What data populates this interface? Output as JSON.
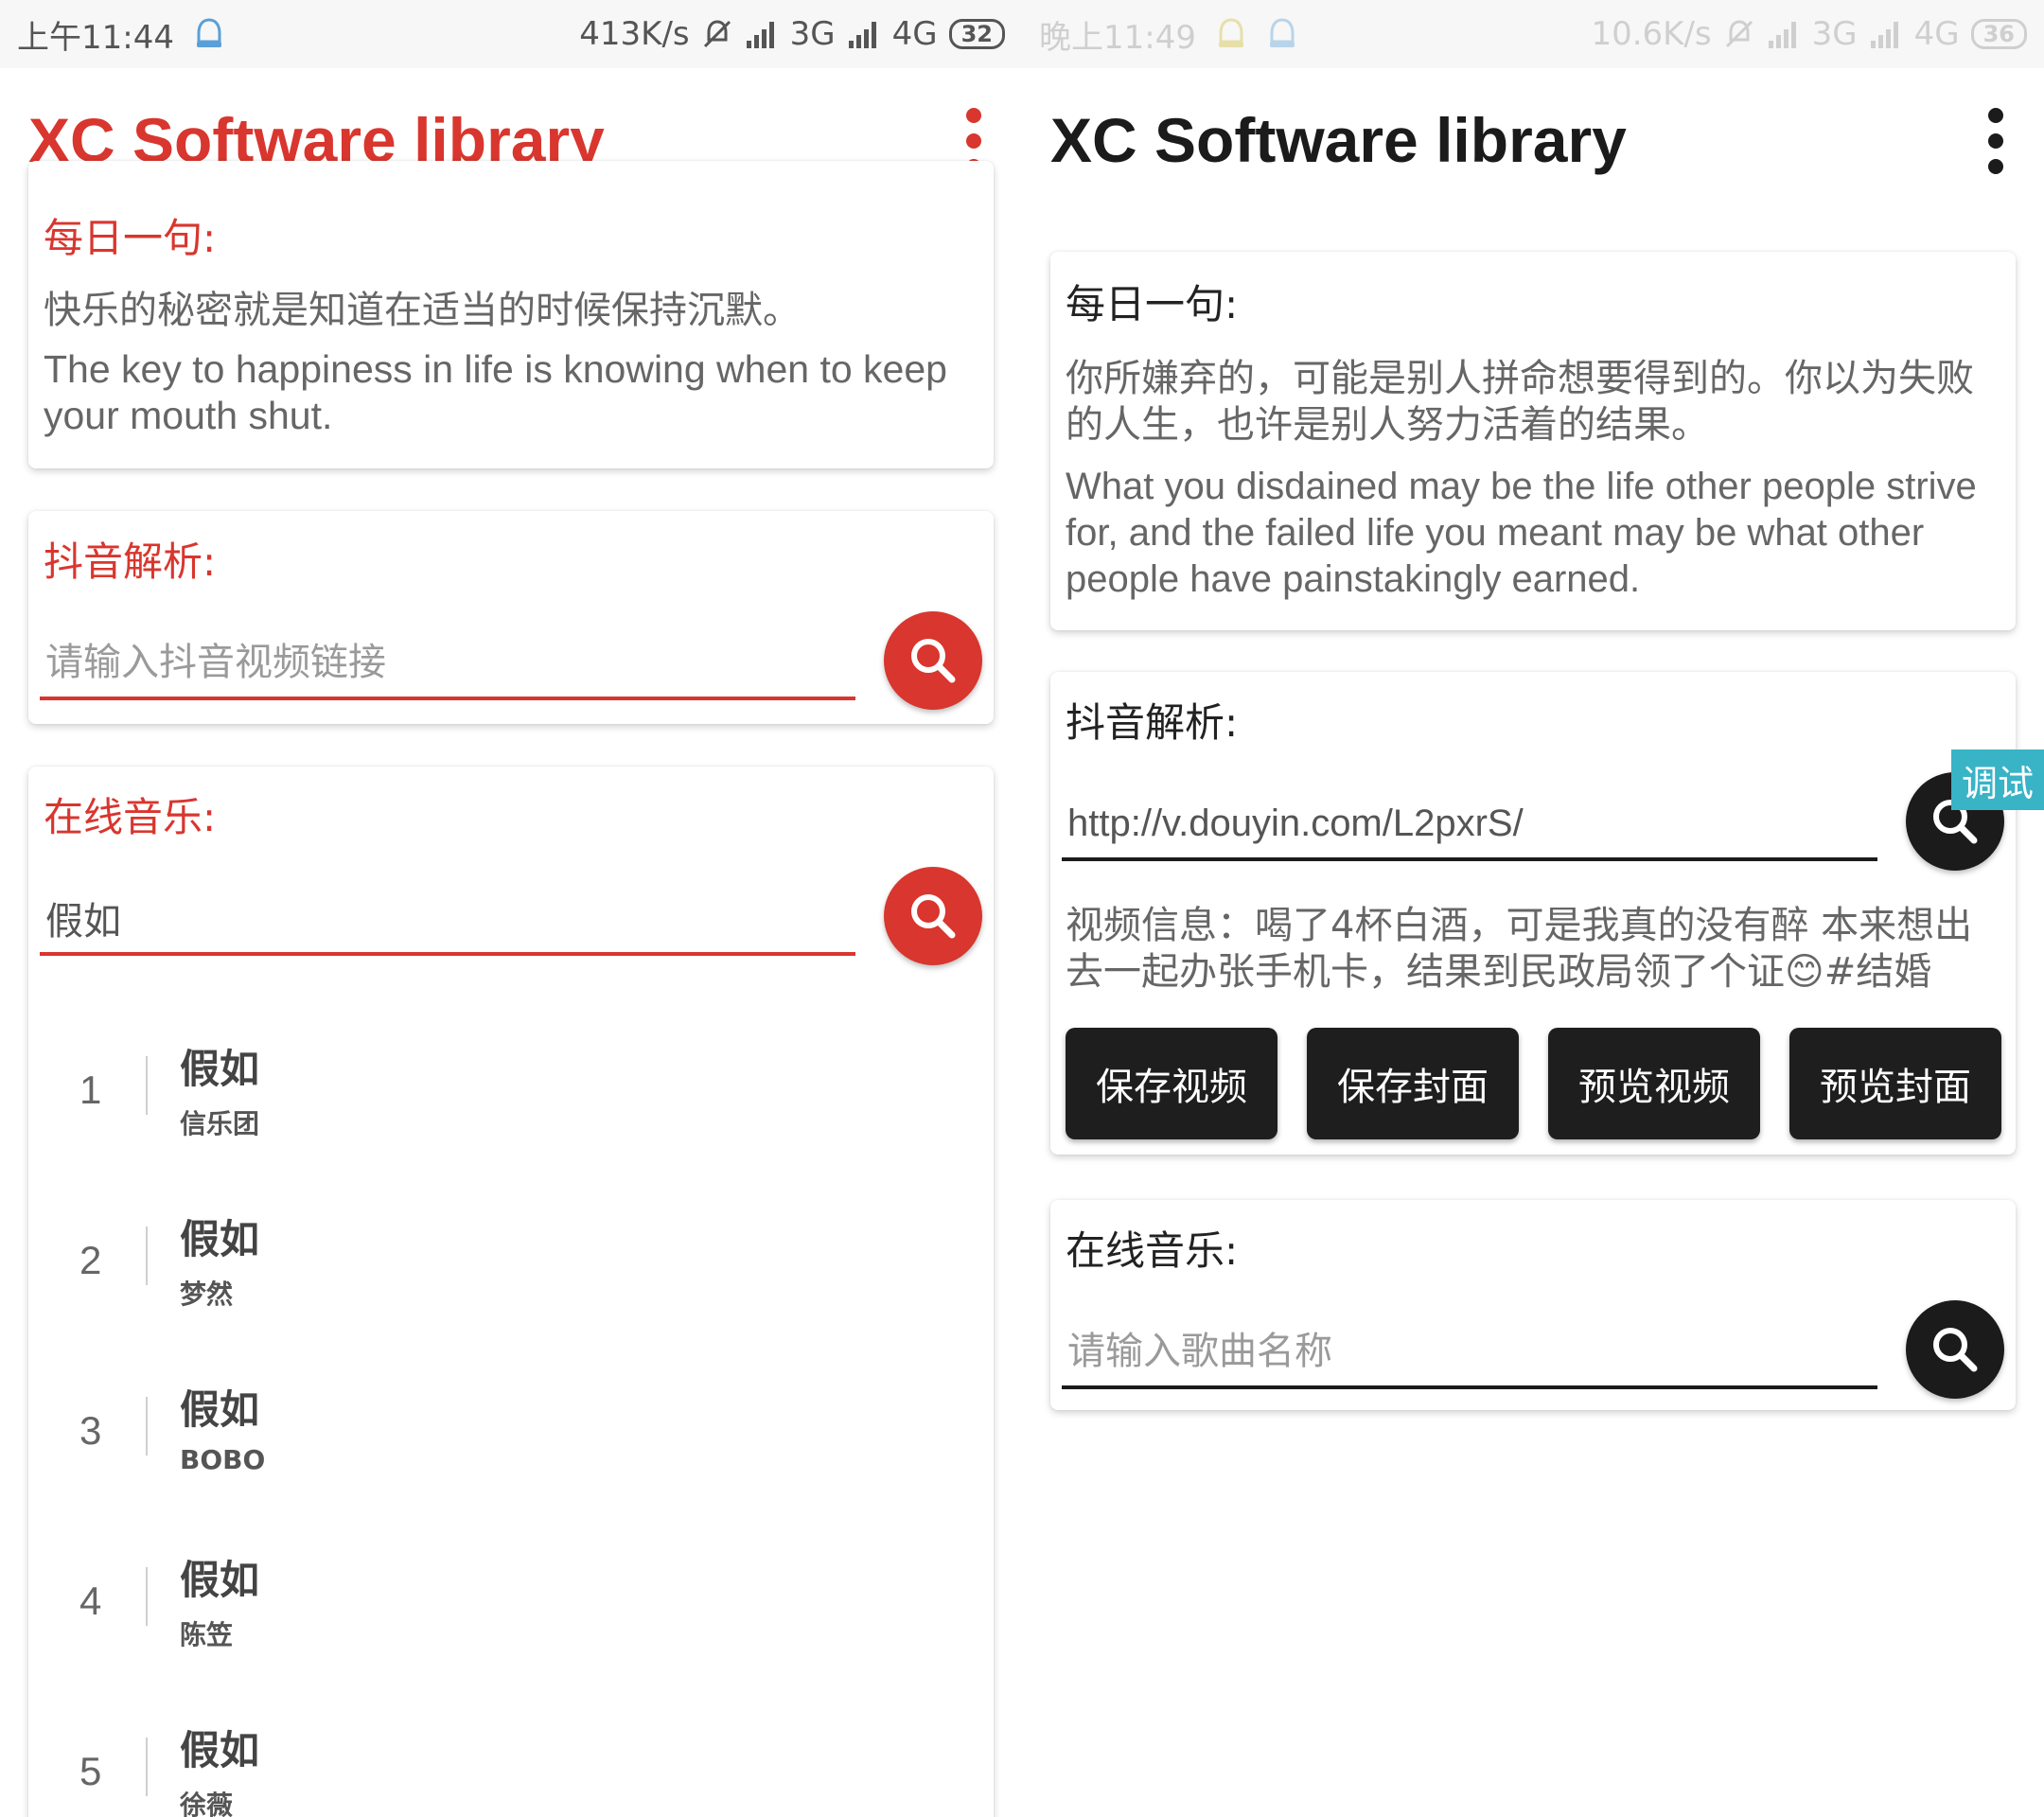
{
  "left": {
    "statusbar": {
      "time": "上午11:44",
      "speed": "413K/s",
      "net1": "3G",
      "net2": "4G",
      "battery": "32"
    },
    "app_title": "XC Software library",
    "daily": {
      "heading": "每日一句:",
      "zh": "快乐的秘密就是知道在适当的时候保持沉默。",
      "en": "The key to happiness in life is knowing when to keep your mouth shut."
    },
    "douyin": {
      "heading": "抖音解析:",
      "placeholder": "请输入抖音视频链接"
    },
    "music": {
      "heading": "在线音乐:",
      "value": "假如",
      "results": [
        {
          "num": "1",
          "title": "假如",
          "artist": "信乐团"
        },
        {
          "num": "2",
          "title": "假如",
          "artist": "梦然"
        },
        {
          "num": "3",
          "title": "假如",
          "artist": "BOBO"
        },
        {
          "num": "4",
          "title": "假如",
          "artist": "陈笠"
        },
        {
          "num": "5",
          "title": "假如",
          "artist": "徐薇"
        }
      ]
    }
  },
  "right": {
    "statusbar": {
      "time": "晚上11:49",
      "speed": "10.6K/s",
      "net1": "3G",
      "net2": "4G",
      "battery": "36"
    },
    "app_title": "XC Software library",
    "daily": {
      "heading": "每日一句:",
      "zh": "你所嫌弃的，可能是别人拼命想要得到的。你以为失败的人生，也许是别人努力活着的结果。",
      "en": "What you disdained may be the life other people strive for, and the failed life you meant may be what other people have painstakingly earned."
    },
    "douyin": {
      "heading": "抖音解析:",
      "value": "http://v.douyin.com/L2pxrS/",
      "video_info": "视频信息：喝了4杯白酒，可是我真的没有醉 本来想出去一起办张手机卡，结果到民政局领了个证😊#结婚",
      "buttons": [
        "保存视频",
        "保存封面",
        "预览视频",
        "预览封面"
      ],
      "debug_label": "调试"
    },
    "music": {
      "heading": "在线音乐:",
      "placeholder": "请输入歌曲名称"
    }
  },
  "colors": {
    "accent_red": "#d8362e",
    "dark": "#1b1b1b",
    "debug_teal": "#39b3c6"
  },
  "icons": [
    "menu-icon",
    "search-icon",
    "bell-off-icon",
    "signal-icon",
    "notification-icon"
  ]
}
